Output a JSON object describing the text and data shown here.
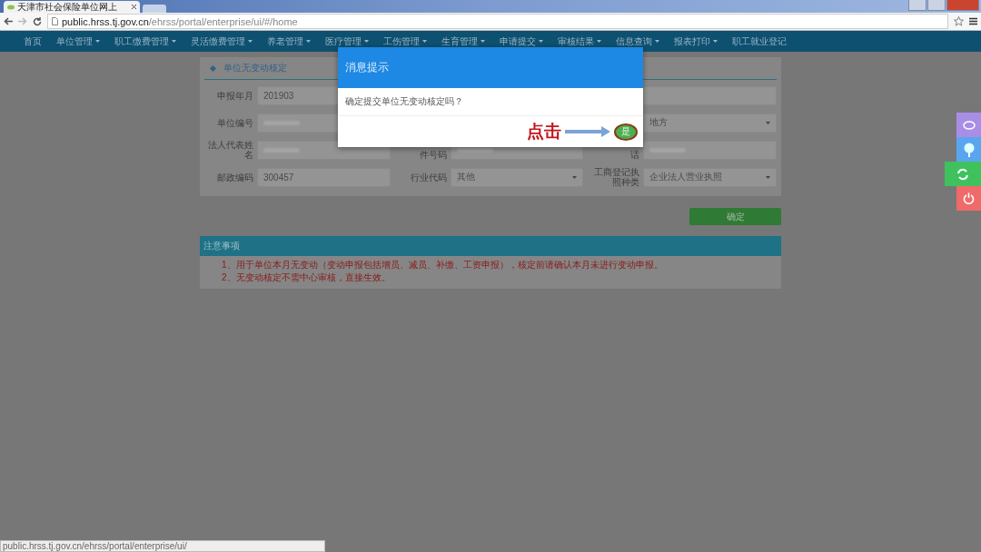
{
  "browser": {
    "tab_title": "天津市社会保险单位网上",
    "url": {
      "host": "public.hrss.tj.gov.cn",
      "path": "/ehrss/portal/enterprise/ui/#/home"
    },
    "status_text": "public.hrss.tj.gov.cn/ehrss/portal/enterprise/ui/"
  },
  "nav": [
    {
      "label": "首页",
      "has_menu": false
    },
    {
      "label": "单位管理",
      "has_menu": true
    },
    {
      "label": "职工缴费管理",
      "has_menu": true
    },
    {
      "label": "灵活缴费管理",
      "has_menu": true
    },
    {
      "label": "养老管理",
      "has_menu": true
    },
    {
      "label": "医疗管理",
      "has_menu": true
    },
    {
      "label": "工伤管理",
      "has_menu": true
    },
    {
      "label": "生育管理",
      "has_menu": true
    },
    {
      "label": "申请提交",
      "has_menu": true
    },
    {
      "label": "审核结果",
      "has_menu": true
    },
    {
      "label": "信息查询",
      "has_menu": true
    },
    {
      "label": "报表打印",
      "has_menu": true
    },
    {
      "label": "职工就业登记",
      "has_menu": false
    }
  ],
  "panel": {
    "title": "单位无变动核定",
    "fields": [
      {
        "label": "申报年月",
        "kind": "text",
        "value": "201903"
      },
      {
        "kind": "empty"
      },
      {
        "kind": "empty"
      },
      {
        "label": "单位编号",
        "kind": "blurred"
      },
      {
        "kind": "empty"
      },
      {
        "kind": "select",
        "value": "地方"
      },
      {
        "label": "法人代表姓名",
        "kind": "blurred"
      },
      {
        "label": "件号码",
        "kind": "blurred"
      },
      {
        "label": "话",
        "kind": "blurred"
      },
      {
        "label": "邮政编码",
        "kind": "text",
        "value": "300457"
      },
      {
        "label": "行业代码",
        "kind": "select",
        "value": "其他"
      },
      {
        "label": "工商登记执照种类",
        "kind": "select",
        "value": "企业法人营业执照"
      }
    ],
    "submit": "确定"
  },
  "notes": {
    "title": "注意事项",
    "items": [
      "1、用于单位本月无变动（变动申报包括增员、减员、补缴、工资申报），核定前请确认本月未进行变动申报。",
      "2、无变动核定不需中心审核，直接生效。"
    ]
  },
  "dialog": {
    "title": "消息提示",
    "message": "确定提交单位无变动核定吗？",
    "annotation": "点击",
    "confirm": "是"
  }
}
